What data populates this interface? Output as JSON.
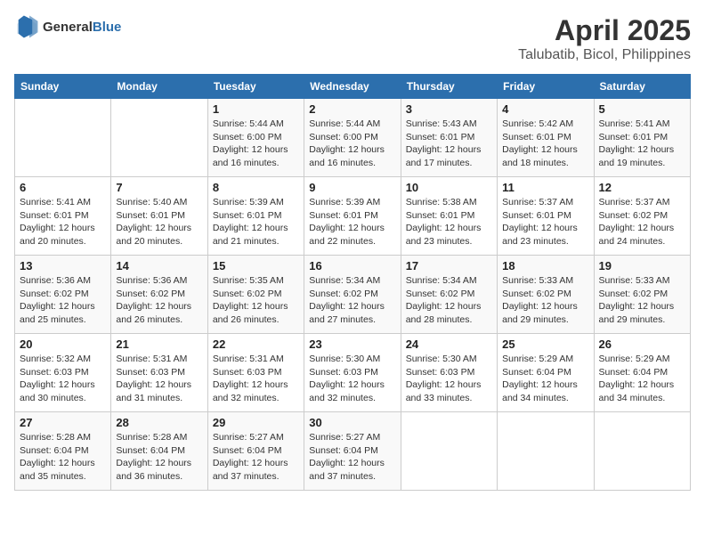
{
  "header": {
    "logo_general": "General",
    "logo_blue": "Blue",
    "title": "April 2025",
    "subtitle": "Talubatib, Bicol, Philippines"
  },
  "calendar": {
    "days_of_week": [
      "Sunday",
      "Monday",
      "Tuesday",
      "Wednesday",
      "Thursday",
      "Friday",
      "Saturday"
    ],
    "weeks": [
      [
        {
          "day": "",
          "sunrise": "",
          "sunset": "",
          "daylight": ""
        },
        {
          "day": "",
          "sunrise": "",
          "sunset": "",
          "daylight": ""
        },
        {
          "day": "1",
          "sunrise": "Sunrise: 5:44 AM",
          "sunset": "Sunset: 6:00 PM",
          "daylight": "Daylight: 12 hours and 16 minutes."
        },
        {
          "day": "2",
          "sunrise": "Sunrise: 5:44 AM",
          "sunset": "Sunset: 6:00 PM",
          "daylight": "Daylight: 12 hours and 16 minutes."
        },
        {
          "day": "3",
          "sunrise": "Sunrise: 5:43 AM",
          "sunset": "Sunset: 6:01 PM",
          "daylight": "Daylight: 12 hours and 17 minutes."
        },
        {
          "day": "4",
          "sunrise": "Sunrise: 5:42 AM",
          "sunset": "Sunset: 6:01 PM",
          "daylight": "Daylight: 12 hours and 18 minutes."
        },
        {
          "day": "5",
          "sunrise": "Sunrise: 5:41 AM",
          "sunset": "Sunset: 6:01 PM",
          "daylight": "Daylight: 12 hours and 19 minutes."
        }
      ],
      [
        {
          "day": "6",
          "sunrise": "Sunrise: 5:41 AM",
          "sunset": "Sunset: 6:01 PM",
          "daylight": "Daylight: 12 hours and 20 minutes."
        },
        {
          "day": "7",
          "sunrise": "Sunrise: 5:40 AM",
          "sunset": "Sunset: 6:01 PM",
          "daylight": "Daylight: 12 hours and 20 minutes."
        },
        {
          "day": "8",
          "sunrise": "Sunrise: 5:39 AM",
          "sunset": "Sunset: 6:01 PM",
          "daylight": "Daylight: 12 hours and 21 minutes."
        },
        {
          "day": "9",
          "sunrise": "Sunrise: 5:39 AM",
          "sunset": "Sunset: 6:01 PM",
          "daylight": "Daylight: 12 hours and 22 minutes."
        },
        {
          "day": "10",
          "sunrise": "Sunrise: 5:38 AM",
          "sunset": "Sunset: 6:01 PM",
          "daylight": "Daylight: 12 hours and 23 minutes."
        },
        {
          "day": "11",
          "sunrise": "Sunrise: 5:37 AM",
          "sunset": "Sunset: 6:01 PM",
          "daylight": "Daylight: 12 hours and 23 minutes."
        },
        {
          "day": "12",
          "sunrise": "Sunrise: 5:37 AM",
          "sunset": "Sunset: 6:02 PM",
          "daylight": "Daylight: 12 hours and 24 minutes."
        }
      ],
      [
        {
          "day": "13",
          "sunrise": "Sunrise: 5:36 AM",
          "sunset": "Sunset: 6:02 PM",
          "daylight": "Daylight: 12 hours and 25 minutes."
        },
        {
          "day": "14",
          "sunrise": "Sunrise: 5:36 AM",
          "sunset": "Sunset: 6:02 PM",
          "daylight": "Daylight: 12 hours and 26 minutes."
        },
        {
          "day": "15",
          "sunrise": "Sunrise: 5:35 AM",
          "sunset": "Sunset: 6:02 PM",
          "daylight": "Daylight: 12 hours and 26 minutes."
        },
        {
          "day": "16",
          "sunrise": "Sunrise: 5:34 AM",
          "sunset": "Sunset: 6:02 PM",
          "daylight": "Daylight: 12 hours and 27 minutes."
        },
        {
          "day": "17",
          "sunrise": "Sunrise: 5:34 AM",
          "sunset": "Sunset: 6:02 PM",
          "daylight": "Daylight: 12 hours and 28 minutes."
        },
        {
          "day": "18",
          "sunrise": "Sunrise: 5:33 AM",
          "sunset": "Sunset: 6:02 PM",
          "daylight": "Daylight: 12 hours and 29 minutes."
        },
        {
          "day": "19",
          "sunrise": "Sunrise: 5:33 AM",
          "sunset": "Sunset: 6:02 PM",
          "daylight": "Daylight: 12 hours and 29 minutes."
        }
      ],
      [
        {
          "day": "20",
          "sunrise": "Sunrise: 5:32 AM",
          "sunset": "Sunset: 6:03 PM",
          "daylight": "Daylight: 12 hours and 30 minutes."
        },
        {
          "day": "21",
          "sunrise": "Sunrise: 5:31 AM",
          "sunset": "Sunset: 6:03 PM",
          "daylight": "Daylight: 12 hours and 31 minutes."
        },
        {
          "day": "22",
          "sunrise": "Sunrise: 5:31 AM",
          "sunset": "Sunset: 6:03 PM",
          "daylight": "Daylight: 12 hours and 32 minutes."
        },
        {
          "day": "23",
          "sunrise": "Sunrise: 5:30 AM",
          "sunset": "Sunset: 6:03 PM",
          "daylight": "Daylight: 12 hours and 32 minutes."
        },
        {
          "day": "24",
          "sunrise": "Sunrise: 5:30 AM",
          "sunset": "Sunset: 6:03 PM",
          "daylight": "Daylight: 12 hours and 33 minutes."
        },
        {
          "day": "25",
          "sunrise": "Sunrise: 5:29 AM",
          "sunset": "Sunset: 6:04 PM",
          "daylight": "Daylight: 12 hours and 34 minutes."
        },
        {
          "day": "26",
          "sunrise": "Sunrise: 5:29 AM",
          "sunset": "Sunset: 6:04 PM",
          "daylight": "Daylight: 12 hours and 34 minutes."
        }
      ],
      [
        {
          "day": "27",
          "sunrise": "Sunrise: 5:28 AM",
          "sunset": "Sunset: 6:04 PM",
          "daylight": "Daylight: 12 hours and 35 minutes."
        },
        {
          "day": "28",
          "sunrise": "Sunrise: 5:28 AM",
          "sunset": "Sunset: 6:04 PM",
          "daylight": "Daylight: 12 hours and 36 minutes."
        },
        {
          "day": "29",
          "sunrise": "Sunrise: 5:27 AM",
          "sunset": "Sunset: 6:04 PM",
          "daylight": "Daylight: 12 hours and 37 minutes."
        },
        {
          "day": "30",
          "sunrise": "Sunrise: 5:27 AM",
          "sunset": "Sunset: 6:04 PM",
          "daylight": "Daylight: 12 hours and 37 minutes."
        },
        {
          "day": "",
          "sunrise": "",
          "sunset": "",
          "daylight": ""
        },
        {
          "day": "",
          "sunrise": "",
          "sunset": "",
          "daylight": ""
        },
        {
          "day": "",
          "sunrise": "",
          "sunset": "",
          "daylight": ""
        }
      ]
    ]
  }
}
